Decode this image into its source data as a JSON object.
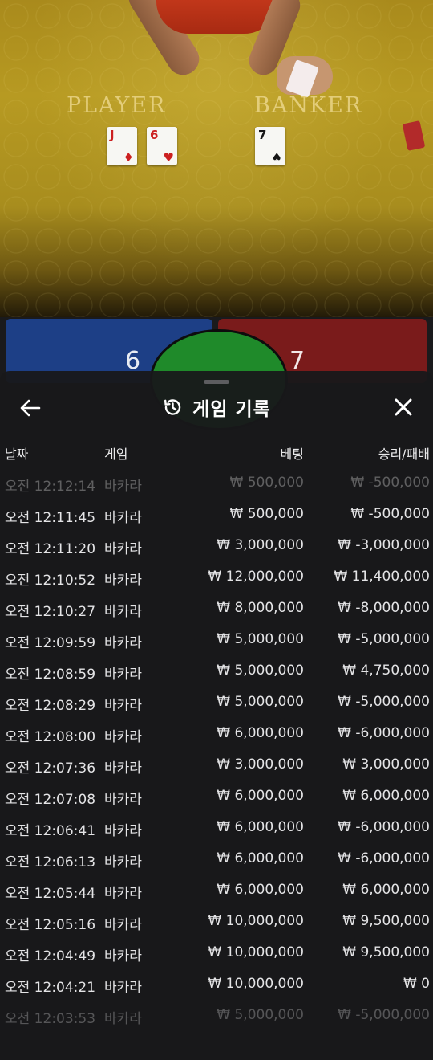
{
  "table": {
    "player_label": "PLAYER",
    "banker_label": "BANKER",
    "player_cards": [
      {
        "rank": "J",
        "suit": "♦"
      },
      {
        "rank": "6",
        "suit": "♥"
      }
    ],
    "banker_cards": [
      {
        "rank": "7",
        "suit": "♠"
      }
    ],
    "player_score": "6",
    "banker_score": "7"
  },
  "history": {
    "title": "게임 기록",
    "columns": {
      "date": "날짜",
      "game": "게임",
      "bet": "베팅",
      "result": "승리/패배"
    },
    "rows": [
      {
        "date": "오전 12:12:14",
        "game": "바카라",
        "bet": "₩ 500,000",
        "result": "₩ -500,000"
      },
      {
        "date": "오전 12:11:45",
        "game": "바카라",
        "bet": "₩ 500,000",
        "result": "₩ -500,000"
      },
      {
        "date": "오전 12:11:20",
        "game": "바카라",
        "bet": "₩ 3,000,000",
        "result": "₩ -3,000,000"
      },
      {
        "date": "오전 12:10:52",
        "game": "바카라",
        "bet": "₩ 12,000,000",
        "result": "₩ 11,400,000"
      },
      {
        "date": "오전 12:10:27",
        "game": "바카라",
        "bet": "₩ 8,000,000",
        "result": "₩ -8,000,000"
      },
      {
        "date": "오전 12:09:59",
        "game": "바카라",
        "bet": "₩ 5,000,000",
        "result": "₩ -5,000,000"
      },
      {
        "date": "오전 12:08:59",
        "game": "바카라",
        "bet": "₩ 5,000,000",
        "result": "₩ 4,750,000"
      },
      {
        "date": "오전 12:08:29",
        "game": "바카라",
        "bet": "₩ 5,000,000",
        "result": "₩ -5,000,000"
      },
      {
        "date": "오전 12:08:00",
        "game": "바카라",
        "bet": "₩ 6,000,000",
        "result": "₩ -6,000,000"
      },
      {
        "date": "오전 12:07:36",
        "game": "바카라",
        "bet": "₩ 3,000,000",
        "result": "₩ 3,000,000"
      },
      {
        "date": "오전 12:07:08",
        "game": "바카라",
        "bet": "₩ 6,000,000",
        "result": "₩ 6,000,000"
      },
      {
        "date": "오전 12:06:41",
        "game": "바카라",
        "bet": "₩ 6,000,000",
        "result": "₩ -6,000,000"
      },
      {
        "date": "오전 12:06:13",
        "game": "바카라",
        "bet": "₩ 6,000,000",
        "result": "₩ -6,000,000"
      },
      {
        "date": "오전 12:05:44",
        "game": "바카라",
        "bet": "₩ 6,000,000",
        "result": "₩ 6,000,000"
      },
      {
        "date": "오전 12:05:16",
        "game": "바카라",
        "bet": "₩ 10,000,000",
        "result": "₩ 9,500,000"
      },
      {
        "date": "오전 12:04:49",
        "game": "바카라",
        "bet": "₩ 10,000,000",
        "result": "₩ 9,500,000"
      },
      {
        "date": "오전 12:04:21",
        "game": "바카라",
        "bet": "₩ 10,000,000",
        "result": "₩ 0"
      },
      {
        "date": "오전 12:03:53",
        "game": "바카라",
        "bet": "₩ 5,000,000",
        "result": "₩ -5,000,000"
      }
    ]
  },
  "icons": {
    "back": "arrow-left-icon",
    "history": "history-icon",
    "close": "close-icon"
  },
  "colors": {
    "felt": "#b0921f",
    "player_panel": "#1d3f86",
    "banker_panel": "#7a1b1b",
    "sheet_bg": "#18181a"
  }
}
